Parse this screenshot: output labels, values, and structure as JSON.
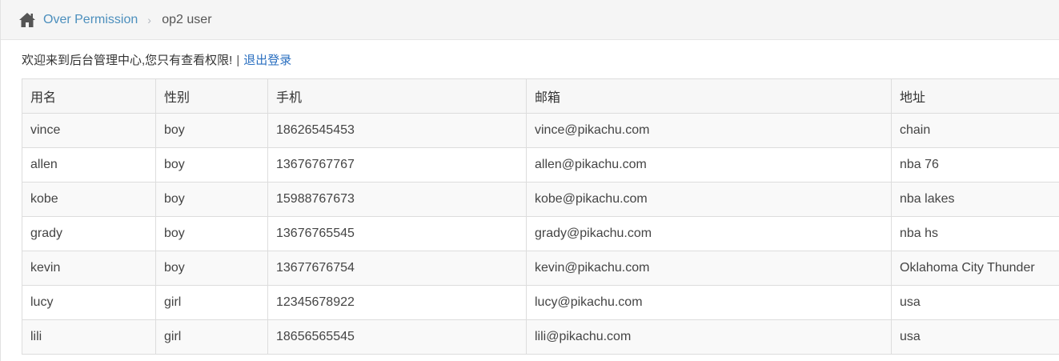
{
  "breadcrumb": {
    "home_icon": "home-icon",
    "link_label": "Over Permission",
    "separator": "›",
    "current": "op2 user"
  },
  "welcome": {
    "message": "欢迎来到后台管理中心,您只有查看权限!",
    "separator": "|",
    "logout_label": "退出登录"
  },
  "table": {
    "headers": [
      "用名",
      "性别",
      "手机",
      "邮箱",
      "地址"
    ],
    "rows": [
      [
        "vince",
        "boy",
        "18626545453",
        "vince@pikachu.com",
        "chain"
      ],
      [
        "allen",
        "boy",
        "13676767767",
        "allen@pikachu.com",
        "nba 76"
      ],
      [
        "kobe",
        "boy",
        "15988767673",
        "kobe@pikachu.com",
        "nba lakes"
      ],
      [
        "grady",
        "boy",
        "13676765545",
        "grady@pikachu.com",
        "nba hs"
      ],
      [
        "kevin",
        "boy",
        "13677676754",
        "kevin@pikachu.com",
        "Oklahoma City Thunder"
      ],
      [
        "lucy",
        "girl",
        "12345678922",
        "lucy@pikachu.com",
        "usa"
      ],
      [
        "lili",
        "girl",
        "18656565545",
        "lili@pikachu.com",
        "usa"
      ]
    ]
  },
  "colors": {
    "link": "#4c8fbd",
    "logout": "#2a6fc0",
    "breadcrumb_bg": "#f5f5f5",
    "border": "#dddddd"
  }
}
